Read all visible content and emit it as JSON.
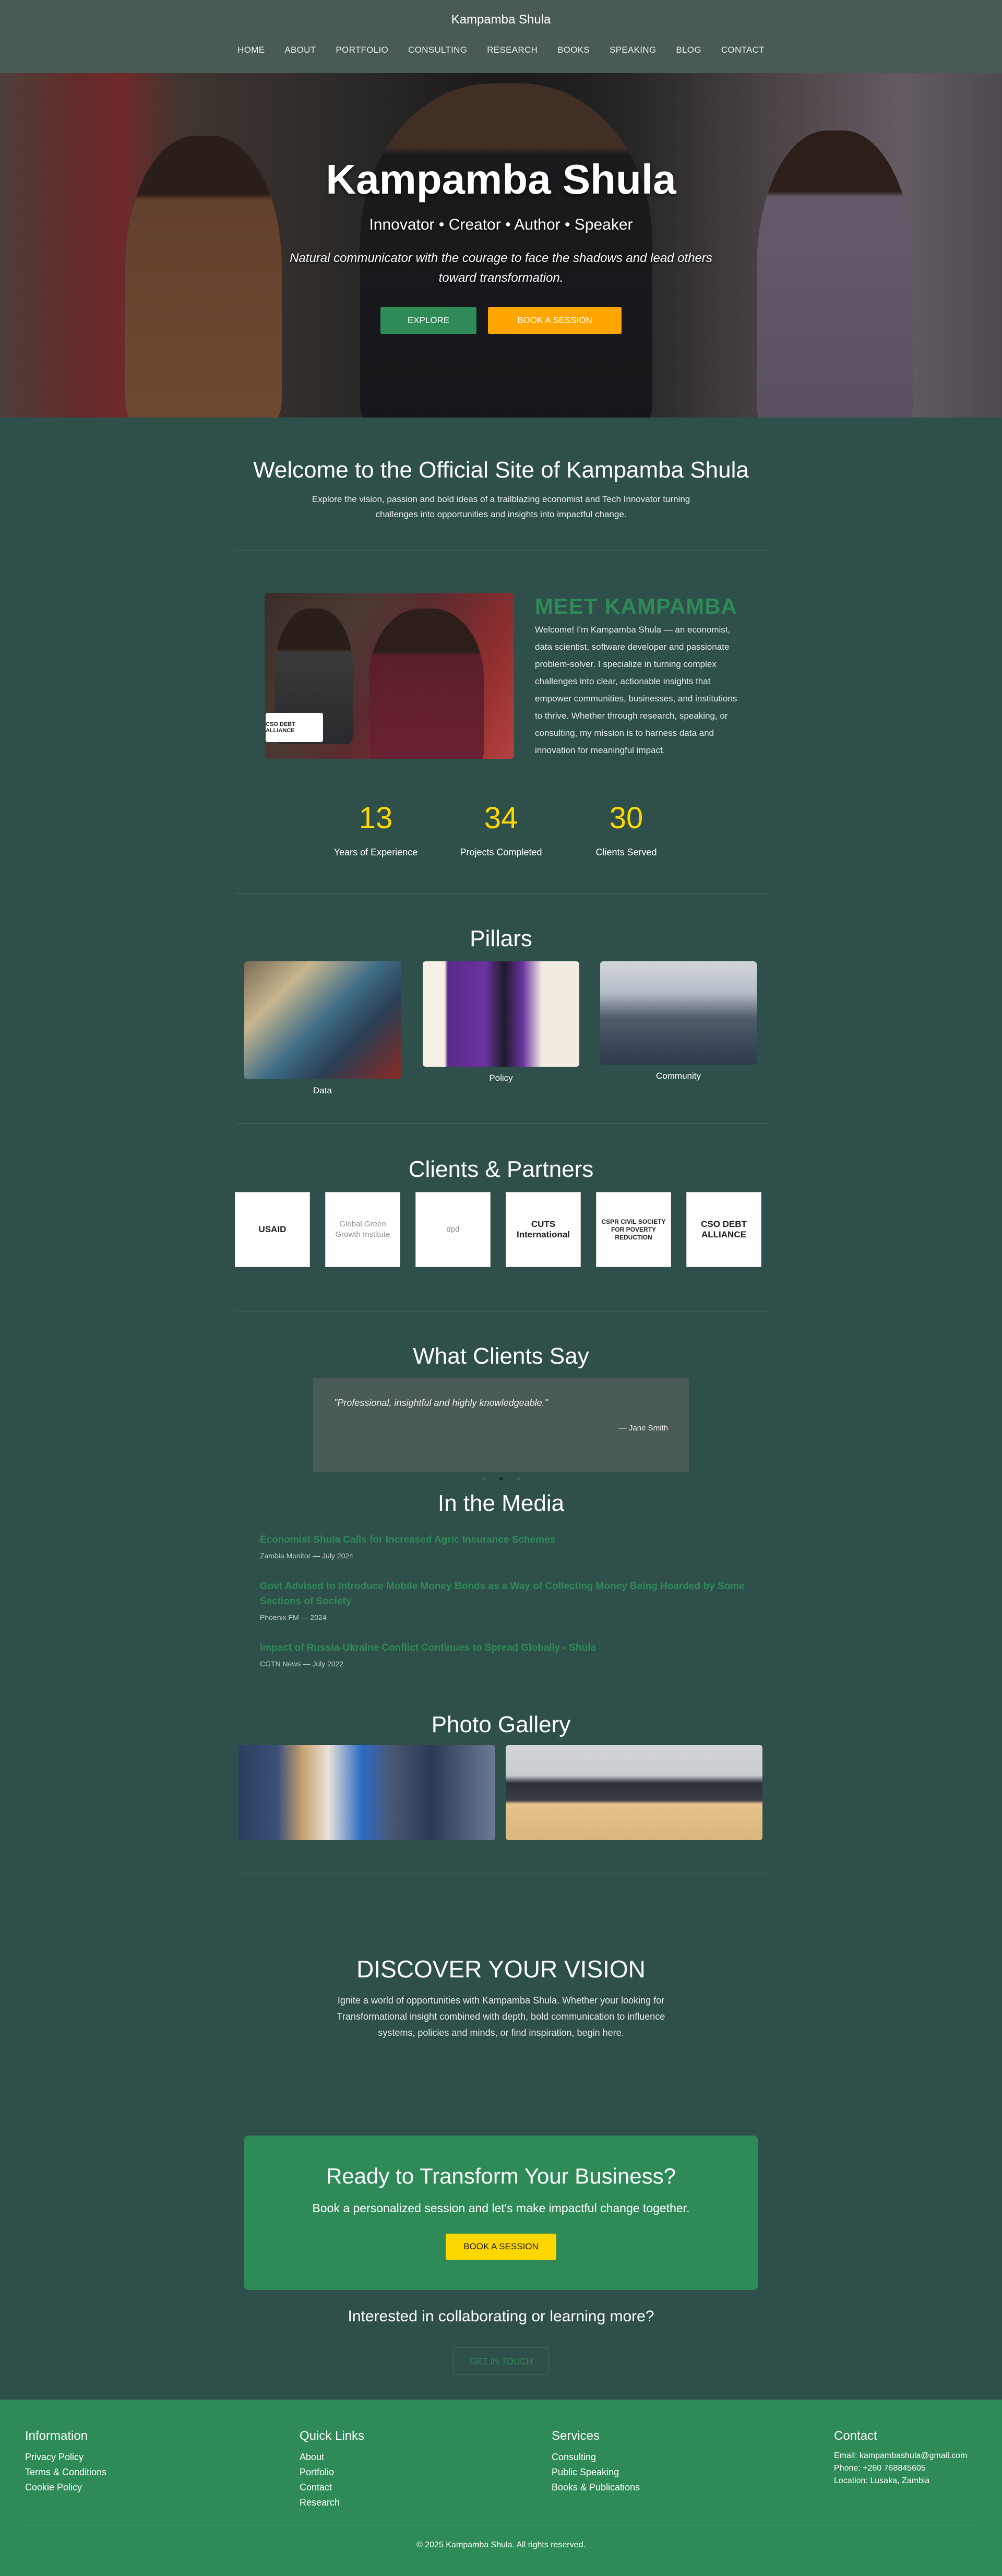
{
  "site_title": "Kampamba Shula",
  "nav": [
    "HOME",
    "ABOUT",
    "PORTFOLIO",
    "CONSULTING",
    "RESEARCH",
    "BOOKS",
    "SPEAKING",
    "BLOG",
    "CONTACT"
  ],
  "hero": {
    "title": "Kampamba Shula",
    "subtitle": "Innovator • Creator • Author • Speaker",
    "tagline": "Natural communicator with the courage to face the shadows and lead others toward transformation.",
    "explore_label": "EXPLORE",
    "book_label": "BOOK A SESSION"
  },
  "welcome": {
    "title": "Welcome to the Official Site of Kampamba Shula",
    "text": "Explore the vision, passion and bold ideas of a trailblazing economist and Tech Innovator turning challenges into opportunities and insights into impactful change."
  },
  "meet": {
    "title": "MEET KAMPAMBA",
    "text": "Welcome! I'm Kampamba Shula — an economist, data scientist, software developer and passionate problem-solver. I specialize in turning complex challenges into clear, actionable insights that empower communities, businesses, and institutions to thrive. Whether through research, speaking, or consulting, my mission is to harness data and innovation for meaningful impact.",
    "photo_logo": "CSO DEBT ALLIANCE"
  },
  "stats": [
    {
      "value": "13",
      "label": "Years of Experience"
    },
    {
      "value": "34",
      "label": "Projects Completed"
    },
    {
      "value": "30",
      "label": "Clients Served"
    }
  ],
  "pillars": {
    "title": "Pillars",
    "items": [
      "Data",
      "Policy",
      "Community"
    ]
  },
  "clients": {
    "title": "Clients & Partners",
    "logos": [
      "USAID",
      "Global Green Growth Institute",
      "dpd",
      "CUTS International",
      "CSPR CIVIL SOCIETY FOR POVERTY REDUCTION",
      "CSO DEBT ALLIANCE"
    ]
  },
  "testimonials": {
    "title": "What Clients Say",
    "quote": "\"Professional, insightful and highly knowledgeable.\"",
    "author": "— Jane Smith"
  },
  "media": {
    "title": "In the Media",
    "items": [
      {
        "title": "Economist Shula Calls for Increased Agric Insurance Schemes",
        "meta": "Zambia Monitor — July 2024"
      },
      {
        "title": "Govt Advised to Introduce Mobile Money Bonds as a Way of Collecting Money Being Hoarded by Some Sections of Society",
        "meta": "Phoenix FM — 2024"
      },
      {
        "title": "Impact of Russia-Ukraine Conflict Continues to Spread Globally - Shula",
        "meta": "CGTN News — July 2022"
      }
    ]
  },
  "gallery": {
    "title": "Photo Gallery"
  },
  "discover": {
    "title": "DISCOVER YOUR VISION",
    "text": "Ignite a world of opportunities with Kampamba Shula. Whether your looking for Transformational insight combined with depth, bold communication to influence systems, policies and minds, or find inspiration, begin here."
  },
  "cta": {
    "title": "Ready to Transform Your Business?",
    "subtitle": "Book a personalized session and let's make impactful change together.",
    "button": "BOOK A SESSION",
    "interest": "Interested in collaborating or learning more?",
    "get_in_touch": "GET IN TOUCH"
  },
  "footer": {
    "information": {
      "title": "Information",
      "links": [
        "Privacy Policy",
        "Terms & Conditions",
        "Cookie Policy"
      ]
    },
    "quick_links": {
      "title": "Quick Links",
      "links": [
        "About",
        "Portfolio",
        "Contact",
        "Research"
      ]
    },
    "services": {
      "title": "Services",
      "links": [
        "Consulting",
        "Public Speaking",
        "Books & Publications"
      ]
    },
    "contact": {
      "title": "Contact",
      "lines": [
        "Email: kampambashula@gmail.com",
        "Phone: +260 768845605",
        "Location: Lusaka, Zambia"
      ]
    },
    "copyright": "© 2025 Kampamba Shula. All rights reserved."
  },
  "colors": {
    "accent_green": "#2e8b57",
    "gold": "#ffd700",
    "orange": "#ffa500",
    "bg": "#2f4f4a"
  }
}
